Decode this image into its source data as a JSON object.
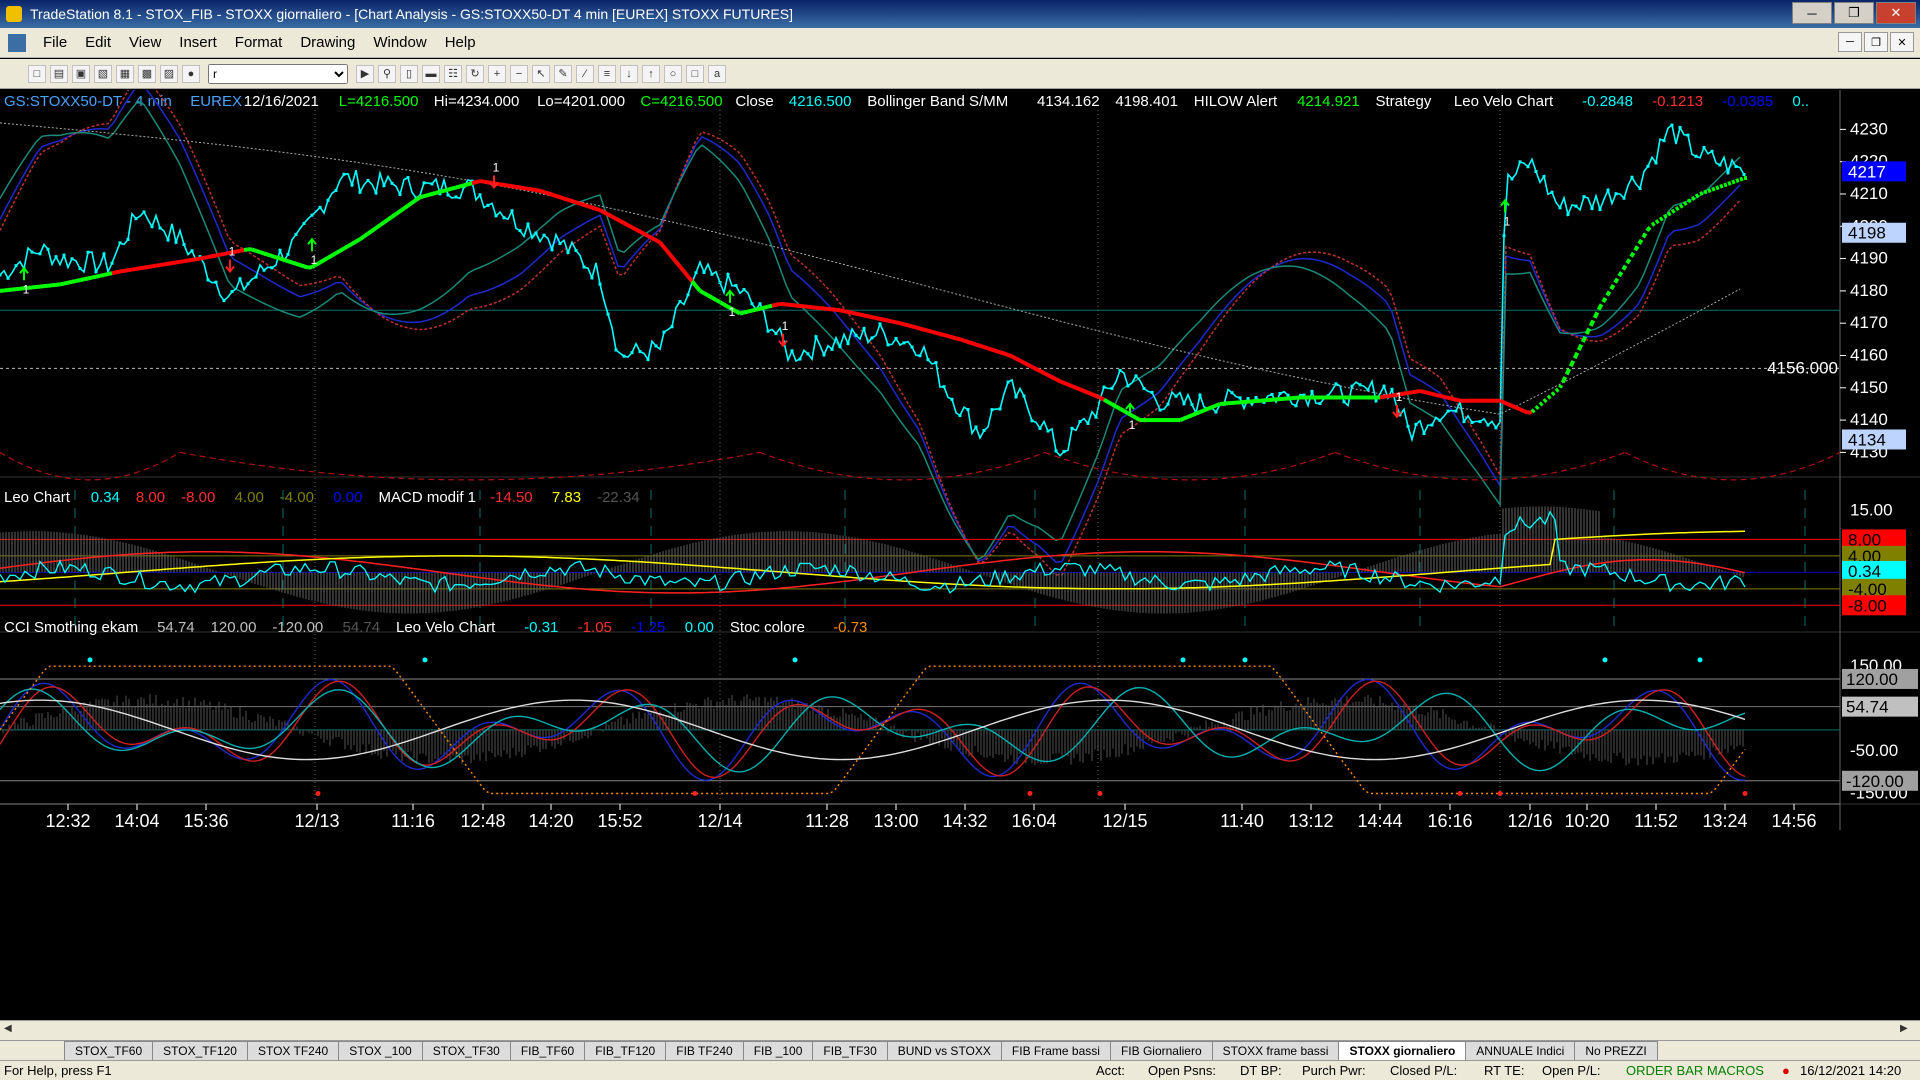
{
  "window": {
    "title": "TradeStation 8.1 - STOX_FIB - STOXX giornaliero - [Chart Analysis - GS:STOXX50-DT  4 min  [EUREX] STOXX FUTURES]"
  },
  "menu": [
    "File",
    "Edit",
    "View",
    "Insert",
    "Format",
    "Drawing",
    "Window",
    "Help"
  ],
  "toolbar": {
    "symbol_value": "r"
  },
  "panel1": {
    "header": [
      {
        "text": "GS:STOXX50-DT - 4 min",
        "color": "#4aa3ff"
      },
      {
        "text": "EUREX",
        "color": "#4aa3ff"
      },
      {
        "text": "12/16/2021",
        "color": "#ffffff"
      },
      {
        "text": "L=4216.500",
        "color": "#00ff00"
      },
      {
        "text": "Hi=4234.000",
        "color": "#ffffff"
      },
      {
        "text": "Lo=4201.000",
        "color": "#ffffff"
      },
      {
        "text": "C=4216.500",
        "color": "#00ff00"
      },
      {
        "text": "Close",
        "color": "#ffffff"
      },
      {
        "text": "4216.500",
        "color": "#00ffff"
      },
      {
        "text": "Bollinger Band S/MM",
        "color": "#ffffff"
      },
      {
        "text": "4134.162",
        "color": "#ffffff"
      },
      {
        "text": "4198.401",
        "color": "#ffffff"
      },
      {
        "text": "HILOW Alert",
        "color": "#ffffff"
      },
      {
        "text": "4214.921",
        "color": "#00ff00"
      },
      {
        "text": "Strategy",
        "color": "#ffffff"
      },
      {
        "text": "Leo Velo Chart",
        "color": "#ffffff"
      },
      {
        "text": "-0.2848",
        "color": "#00ffff"
      },
      {
        "text": "-0.1213",
        "color": "#ff3030"
      },
      {
        "text": "-0.0385",
        "color": "#0000ff"
      },
      {
        "text": "0..",
        "color": "#00ffff"
      }
    ],
    "y_ticks": [
      "4230",
      "4220",
      "4210",
      "4200",
      "4190",
      "4180",
      "4170",
      "4160",
      "4150",
      "4140",
      "4130"
    ],
    "price_flags": [
      {
        "text": "4217",
        "value": 4217,
        "bg": "#0000ff",
        "fg": "#ffffff"
      },
      {
        "text": "4198",
        "value": 4198,
        "bg": "#bcd4ff",
        "fg": "#000000"
      },
      {
        "text": "4134",
        "value": 4134,
        "bg": "#bcd4ff",
        "fg": "#000000"
      }
    ],
    "level_label": "4156.000",
    "marker_label": "1"
  },
  "panel2": {
    "header": [
      {
        "text": "Leo Chart",
        "color": "#ffffff"
      },
      {
        "text": "0.34",
        "color": "#00ffff"
      },
      {
        "text": "8.00",
        "color": "#ff3030"
      },
      {
        "text": "-8.00",
        "color": "#ff3030"
      },
      {
        "text": "4.00",
        "color": "#808000"
      },
      {
        "text": "-4.00",
        "color": "#808000"
      },
      {
        "text": "0.00",
        "color": "#0000ff"
      },
      {
        "text": "MACD modif 1",
        "color": "#ffffff"
      },
      {
        "text": "-14.50",
        "color": "#ff3030"
      },
      {
        "text": "7.83",
        "color": "#ffff00"
      },
      {
        "text": "-22.34",
        "color": "#555555"
      }
    ],
    "y_ticks": [
      "15.00"
    ],
    "value_flags": [
      {
        "text": "8.00",
        "value": 8.0,
        "bg": "#ff0000",
        "fg": "#000000"
      },
      {
        "text": "4.00",
        "value": 4.0,
        "bg": "#808000",
        "fg": "#000000"
      },
      {
        "text": "0.34",
        "value": 0.34,
        "bg": "#00ffff",
        "fg": "#000000"
      },
      {
        "text": "-4.00",
        "value": -4.0,
        "bg": "#808000",
        "fg": "#000000"
      },
      {
        "text": "-8.00",
        "value": -8.0,
        "bg": "#ff0000",
        "fg": "#000000"
      }
    ]
  },
  "panel3": {
    "header": [
      {
        "text": "CCI Smothing ekam",
        "color": "#ffffff"
      },
      {
        "text": "54.74",
        "color": "#c0c0c0"
      },
      {
        "text": "120.00",
        "color": "#c0c0c0"
      },
      {
        "text": "-120.00",
        "color": "#c0c0c0"
      },
      {
        "text": "54.74",
        "color": "#555555"
      },
      {
        "text": "Leo Velo Chart",
        "color": "#ffffff"
      },
      {
        "text": "-0.31",
        "color": "#00ffff"
      },
      {
        "text": "-1.05",
        "color": "#ff3030"
      },
      {
        "text": "-1.25",
        "color": "#0000ff"
      },
      {
        "text": "0.00",
        "color": "#00ffff"
      },
      {
        "text": "Stoc colore",
        "color": "#ffffff"
      },
      {
        "text": "-0.73",
        "color": "#ff8c00"
      }
    ],
    "y_ticks": [
      "150.00",
      "-50.00",
      "-150.00"
    ],
    "value_flags": [
      {
        "text": "120.00",
        "value": 120,
        "bg": "#a0a0a0",
        "fg": "#000000"
      },
      {
        "text": "54.74",
        "value": 54.74,
        "bg": "#c0c0c0",
        "fg": "#000000"
      },
      {
        "text": "-120.00",
        "value": -120,
        "bg": "#a0a0a0",
        "fg": "#000000"
      }
    ]
  },
  "x_axis": {
    "labels": [
      "12:32",
      "14:04",
      "15:36",
      "12/13",
      "11:16",
      "12:48",
      "14:20",
      "15:52",
      "12/14",
      "11:28",
      "13:00",
      "14:32",
      "16:04",
      "12/15",
      "11:40",
      "13:12",
      "14:44",
      "16:16",
      "12/16",
      "10:20",
      "11:52",
      "13:24",
      "14:56"
    ]
  },
  "tabs": [
    "STOX_TF60",
    "STOX_TF120",
    "STOX TF240",
    "STOX _100",
    "STOX_TF30",
    "FIB_TF60",
    "FIB_TF120",
    "FIB TF240",
    "FIB _100",
    "FIB_TF30",
    "BUND vs STOXX",
    "FIB Frame bassi",
    "FIB Giornaliero",
    "STOXX frame bassi",
    "STOXX giornaliero",
    "ANNUALE Indici",
    "No PREZZI"
  ],
  "active_tab": "STOXX giornaliero",
  "status": {
    "help": "For Help, press F1",
    "acct": "Acct:",
    "open_psns": "Open Psns:",
    "dt_bp": "DT BP:",
    "purch_pwr": "Purch Pwr:",
    "closed_pl": "Closed P/L:",
    "rt_te": "RT TE:",
    "open_pl": "Open P/L:",
    "macros": "ORDER BAR  MACROS",
    "datetime": "16/12/2021 14:20"
  },
  "colors": {
    "bg": "#000000",
    "price": "#00ffff",
    "bull": "#00ff00",
    "bear": "#ff0000",
    "upper_band": "#ff3030",
    "lower_band": "#1e2ad0"
  }
}
